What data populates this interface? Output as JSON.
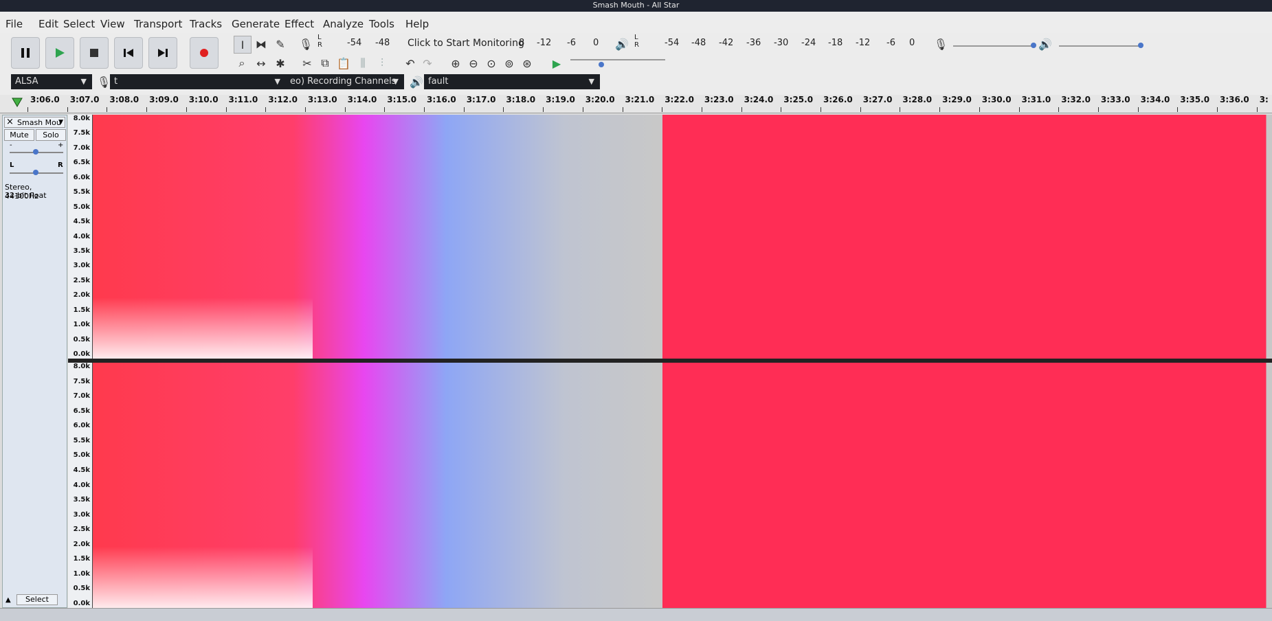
{
  "window": {
    "title": "Smash Mouth - All Star"
  },
  "menu": [
    "File",
    "Edit",
    "Select",
    "View",
    "Transport",
    "Tracks",
    "Generate",
    "Effect",
    "Analyze",
    "Tools",
    "Help"
  ],
  "transport": [
    {
      "name": "pause-button",
      "icon": "pause-icon"
    },
    {
      "name": "play-button",
      "icon": "play-icon"
    },
    {
      "name": "stop-button",
      "icon": "stop-icon"
    },
    {
      "name": "skip-start-button",
      "icon": "skip-start-icon"
    },
    {
      "name": "skip-end-button",
      "icon": "skip-end-icon"
    },
    {
      "name": "record-button",
      "icon": "record-icon"
    }
  ],
  "tools": {
    "row1": [
      "selection-tool",
      "envelope-tool",
      "draw-tool"
    ],
    "row2": [
      "zoom-tool",
      "timeshift-tool",
      "multi-tool"
    ],
    "edit": [
      "cut",
      "copy",
      "paste",
      "trim",
      "silence",
      "undo",
      "redo",
      "zoom-in",
      "zoom-out",
      "fit-selection",
      "fit-project",
      "zoom-toggle"
    ]
  },
  "recording_meter": {
    "lr": "L\nR",
    "ticks": [
      "-54",
      "-48",
      "-12",
      "-6",
      "0"
    ],
    "hint": "Click to Start Monitoring",
    "trail": "8"
  },
  "playback_meter": {
    "lr": "L\nR",
    "ticks": [
      "-54",
      "-48",
      "-42",
      "-36",
      "-30",
      "-24",
      "-18",
      "-12",
      "-6",
      "0"
    ]
  },
  "devices": {
    "host": "ALSA",
    "recording_device": "t",
    "channels": "eo) Recording Channels",
    "playback_device": "fault"
  },
  "timeline": {
    "ticks": [
      "3:06.0",
      "3:07.0",
      "3:08.0",
      "3:09.0",
      "3:10.0",
      "3:11.0",
      "3:12.0",
      "3:13.0",
      "3:14.0",
      "3:15.0",
      "3:16.0",
      "3:17.0",
      "3:18.0",
      "3:19.0",
      "3:20.0",
      "3:21.0",
      "3:22.0",
      "3:23.0",
      "3:24.0",
      "3:25.0",
      "3:26.0",
      "3:27.0",
      "3:28.0",
      "3:29.0",
      "3:30.0",
      "3:31.0",
      "3:32.0",
      "3:33.0",
      "3:34.0",
      "3:35.0",
      "3:36.0",
      "3:"
    ]
  },
  "track": {
    "name": "Smash Mou",
    "mute": "Mute",
    "solo": "Solo",
    "gain_minus": "-",
    "gain_plus": "+",
    "pan_left": "L",
    "pan_right": "R",
    "info_line1": "Stereo, 44100Hz",
    "info_line2": "32-bit float",
    "select": "Select"
  },
  "freq_labels": [
    "8.0k",
    "7.5k",
    "7.0k",
    "6.5k",
    "6.0k",
    "5.5k",
    "5.0k",
    "4.5k",
    "4.0k",
    "3.5k",
    "3.0k",
    "2.5k",
    "2.0k",
    "1.5k",
    "1.0k",
    "0.5k",
    "0.0k"
  ],
  "colors": {
    "spectrogram_hot": "#ff2d55",
    "spectrogram_mid": "#e040fb",
    "spectrogram_low": "#7aa7ff",
    "silence": "#c8c8c8"
  }
}
